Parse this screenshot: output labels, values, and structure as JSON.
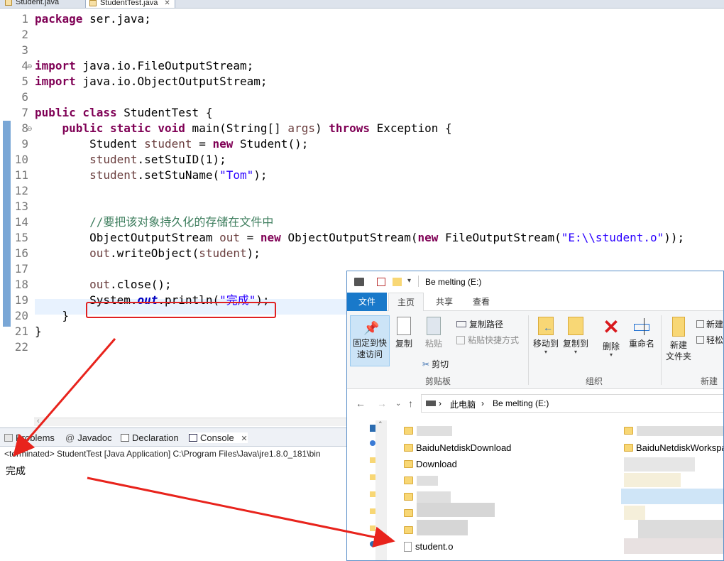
{
  "editor_tabs": [
    {
      "label": "Student.java",
      "active": false
    },
    {
      "label": "StudentTest.java",
      "active": true,
      "close": "✕"
    }
  ],
  "code_lines": [
    {
      "n": "1",
      "segs": [
        {
          "t": "package",
          "c": "kw"
        },
        {
          "t": " ser.java;",
          "c": ""
        }
      ]
    },
    {
      "n": "2",
      "segs": []
    },
    {
      "n": "3",
      "segs": []
    },
    {
      "n": "4",
      "segs": [
        {
          "t": "import",
          "c": "kw"
        },
        {
          "t": " java.io.FileOutputStream;",
          "c": ""
        }
      ]
    },
    {
      "n": "5",
      "segs": [
        {
          "t": "import",
          "c": "kw"
        },
        {
          "t": " java.io.ObjectOutputStream;",
          "c": ""
        }
      ]
    },
    {
      "n": "6",
      "segs": []
    },
    {
      "n": "7",
      "segs": [
        {
          "t": "public class",
          "c": "kw"
        },
        {
          "t": " StudentTest {",
          "c": ""
        }
      ]
    },
    {
      "n": "8",
      "segs": [
        {
          "t": "    ",
          "c": ""
        },
        {
          "t": "public static void",
          "c": "kw"
        },
        {
          "t": " main(String[] ",
          "c": ""
        },
        {
          "t": "args",
          "c": "var"
        },
        {
          "t": ") ",
          "c": ""
        },
        {
          "t": "throws",
          "c": "kw"
        },
        {
          "t": " Exception {",
          "c": ""
        }
      ]
    },
    {
      "n": "9",
      "segs": [
        {
          "t": "        Student ",
          "c": ""
        },
        {
          "t": "student",
          "c": "var"
        },
        {
          "t": " = ",
          "c": ""
        },
        {
          "t": "new",
          "c": "kw"
        },
        {
          "t": " Student();",
          "c": ""
        }
      ]
    },
    {
      "n": "10",
      "segs": [
        {
          "t": "        ",
          "c": ""
        },
        {
          "t": "student",
          "c": "var"
        },
        {
          "t": ".setStuID(1);",
          "c": ""
        }
      ]
    },
    {
      "n": "11",
      "segs": [
        {
          "t": "        ",
          "c": ""
        },
        {
          "t": "student",
          "c": "var"
        },
        {
          "t": ".setStuName(",
          "c": ""
        },
        {
          "t": "\"Tom\"",
          "c": "str"
        },
        {
          "t": ");",
          "c": ""
        }
      ]
    },
    {
      "n": "12",
      "segs": []
    },
    {
      "n": "13",
      "segs": []
    },
    {
      "n": "14",
      "segs": [
        {
          "t": "        ",
          "c": ""
        },
        {
          "t": "//要把该对象持久化的存储在文件中",
          "c": "cm"
        }
      ]
    },
    {
      "n": "15",
      "segs": [
        {
          "t": "        ObjectOutputStream ",
          "c": ""
        },
        {
          "t": "out",
          "c": "var"
        },
        {
          "t": " = ",
          "c": ""
        },
        {
          "t": "new",
          "c": "kw"
        },
        {
          "t": " ObjectOutputStream(",
          "c": ""
        },
        {
          "t": "new",
          "c": "kw"
        },
        {
          "t": " FileOutputStream(",
          "c": ""
        },
        {
          "t": "\"E:\\\\student.o\"",
          "c": "str"
        },
        {
          "t": "));",
          "c": ""
        }
      ]
    },
    {
      "n": "16",
      "segs": [
        {
          "t": "        ",
          "c": ""
        },
        {
          "t": "out",
          "c": "var"
        },
        {
          "t": ".writeObject(",
          "c": ""
        },
        {
          "t": "student",
          "c": "var"
        },
        {
          "t": ");",
          "c": ""
        }
      ]
    },
    {
      "n": "17",
      "segs": []
    },
    {
      "n": "18",
      "segs": [
        {
          "t": "        ",
          "c": ""
        },
        {
          "t": "out",
          "c": "var"
        },
        {
          "t": ".close();",
          "c": ""
        }
      ]
    },
    {
      "n": "19",
      "segs": [
        {
          "t": "        System.",
          "c": ""
        },
        {
          "t": "out",
          "c": "fld"
        },
        {
          "t": ".println(",
          "c": ""
        },
        {
          "t": "\"完成\"",
          "c": "str"
        },
        {
          "t": ");",
          "c": ""
        }
      ]
    },
    {
      "n": "20",
      "segs": [
        {
          "t": "    }",
          "c": ""
        }
      ]
    },
    {
      "n": "21",
      "segs": [
        {
          "t": "}",
          "c": ""
        }
      ]
    },
    {
      "n": "22",
      "segs": []
    }
  ],
  "console": {
    "tabs": {
      "problems": "Problems",
      "javadoc": "Javadoc",
      "declaration": "Declaration",
      "console": "Console",
      "close": "✕"
    },
    "status": "<terminated> StudentTest [Java Application] C:\\Program Files\\Java\\jre1.8.0_181\\bin",
    "output": "完成"
  },
  "explorer": {
    "title": "Be melting (E:)",
    "ribbon_tabs": {
      "file": "文件",
      "home": "主页",
      "share": "共享",
      "view": "查看"
    },
    "clipboard": {
      "pin": "固定到快\n速访问",
      "copy": "复制",
      "paste": "粘贴",
      "copy_path": "复制路径",
      "paste_shortcut": "粘贴快捷方式",
      "cut": "剪切",
      "group": "剪贴板"
    },
    "organize": {
      "move_to": "移动到",
      "copy_to": "复制到",
      "delete": "删除",
      "rename": "重命名",
      "group": "组织"
    },
    "new_group": {
      "new_folder": "新建\n文件夹",
      "new_item": "新建",
      "easy_access": "轻松",
      "group": "新建"
    },
    "address": {
      "pc": "此电脑",
      "drive": "Be melting (E:)",
      "sep": "›"
    },
    "files_left": [
      "BaiduNetdiskDownload",
      "Download",
      "student.o"
    ],
    "files_right": [
      "BaiduNetdiskWorkspa"
    ],
    "colors": {
      "accent": "#1979ca",
      "folder": "#f8d775"
    }
  }
}
